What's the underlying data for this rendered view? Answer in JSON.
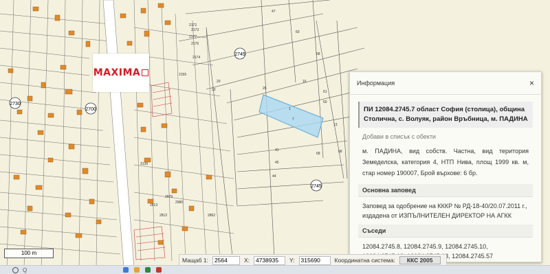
{
  "map": {
    "area_labels": [
      "2745",
      "2745",
      "2730",
      "2700"
    ],
    "logo_text": "MAXIMA",
    "parcel_numbers": [
      "47",
      "60",
      "58",
      "2177",
      "2176",
      "2174",
      "2173",
      "2172",
      "2155",
      "20",
      "23",
      "16",
      "61",
      "60",
      "26",
      "68",
      "1",
      "7",
      "13",
      "41",
      "45",
      "44",
      "68",
      "3139",
      "2979",
      "2813",
      "2980",
      "2812",
      "2862"
    ],
    "scale_label": "100 m"
  },
  "panel": {
    "header_title": "Информация",
    "close_label": "×",
    "parcel_title": "ПИ 12084.2745.7 област София (столица), община Столична, с. Волуяк, район Връбница, м. ПАДИНА",
    "add_link": "Добави в списък с обекти",
    "description": "м. ПАДИНА, вид собств. Частна, вид територия Земеделска, категория 4, НТП Нива, площ 1999 кв. м, стар номер 190007, Брой върхове: 6 бр.",
    "basis_heading": "Основна заповед",
    "basis_text": "Заповед за одобрение на КККР № РД-18-40/20.07.2011 г., издадена от ИЗПЪЛНИТЕЛЕН ДИРЕКТОР НА АГКК",
    "neighbors_heading": "Съседи",
    "neighbors_text": "12084.2745.8, 12084.2745.9, 12084.2745.10, 12084.2745.12, 12084.2745.13, 12084.2745.57"
  },
  "status": {
    "scale_label": "Мащаб 1:",
    "scale_value": "2564",
    "x_label": "X:",
    "x_value": "4738935",
    "y_label": "Y:",
    "y_value": "315690",
    "crs_label": "Координатна система:",
    "crs_value": "ККС 2005"
  },
  "taskbar": {
    "search_label": "Q"
  },
  "colors": {
    "map_bg": "#f4f1de",
    "building": "#e08a2a",
    "selected_parcel": "#a9d8f2",
    "road": "#ffffff"
  }
}
